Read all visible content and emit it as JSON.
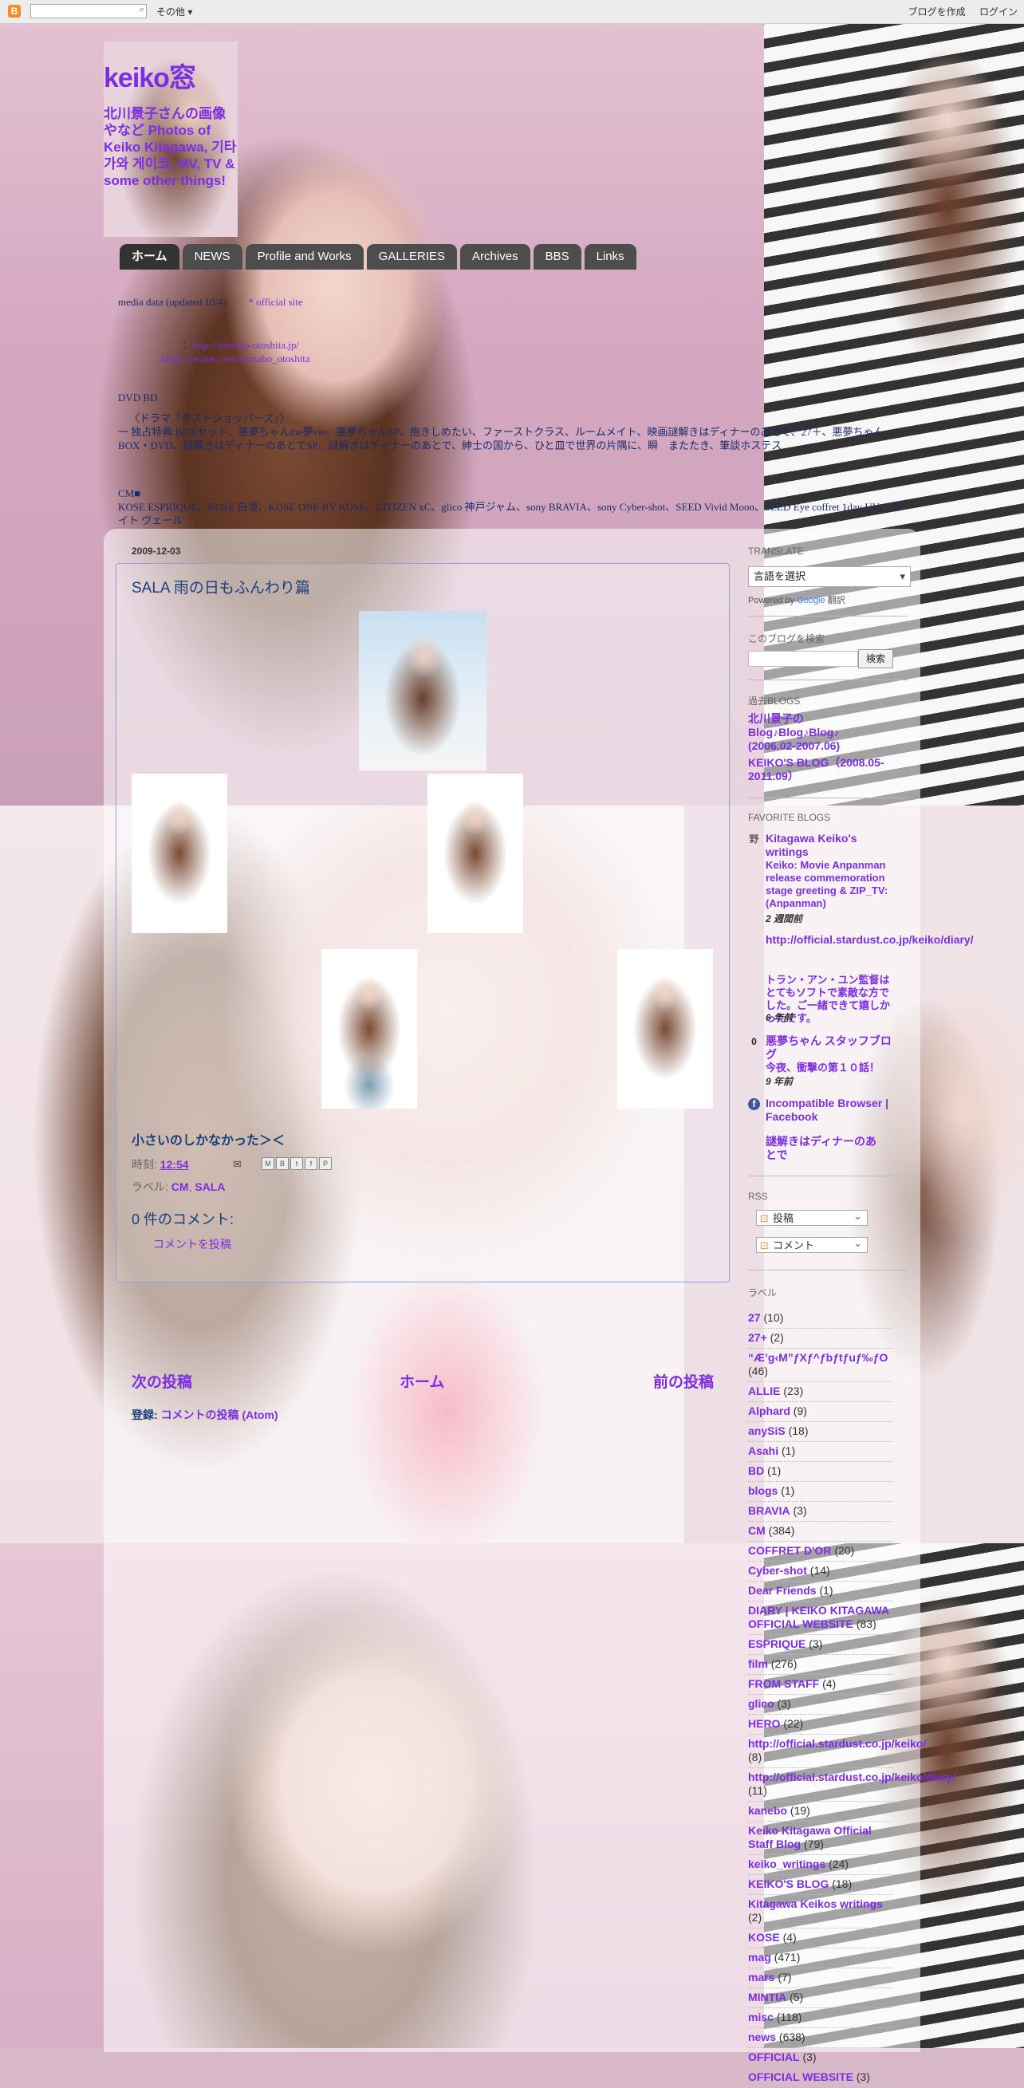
{
  "navbar": {
    "logo": "B",
    "search_icon": "search-icon",
    "more": "その他",
    "create_blog": "ブログを作成",
    "login": "ログイン"
  },
  "header": {
    "title": "keiko窓",
    "description": "北川景子さんの画像やなど Photos of Keiko Kitagawa, 기타가와 게이코, MV, TV & some other things!"
  },
  "tabs": [
    "ホーム",
    "NEWS",
    "Profile and Works",
    "GALLERIES",
    "Archives",
    "BBS",
    "Links"
  ],
  "topinfo": {
    "line1a": "media data (updated 10/4)",
    "line1b": "* official site",
    "line2_url": "http://sumaho-otoshita.jp/",
    "line3_url": "https://twitter.com/sumaho_otoshita",
    "line4": "DVD BD",
    "line5": "〈ドラマ「ダストショッパーズ」〉",
    "line6": "一 独占特典 BOXセット、悪夢ちゃんthe夢vie、悪夢ちゃんSP、抱きしめたい、ファーストクラス、ルームメイト、映画謎解きはディナーのあとで、27＋、悪夢ちゃん BOX・DVD、謎解きはディナーのあとでSP、謎解きはディナーのあとで、紳士の国から、ひと皿で世界の片隅に、瞬　またたき、筆談ホステス",
    "line7": "CM■",
    "line8": "KOSE ESPRIQUE、KOSE 白澄、KOSE ONE BY KOSE、CITIZEN xC、glico 神戸ジャム、sony BRAVIA、sony Cyber-shot、SEED Vivid Moon、SEED Eye coffret 1day UV、ライト ヴェール"
  },
  "post": {
    "date": "2009-12-03",
    "title": "SALA 雨の日もふんわり篇",
    "closing_line": "小さいのしかなかった＞＜",
    "posted_label": "時刻:",
    "time": "12:54",
    "labels_label": "ラベル:",
    "labels": [
      "CM",
      "SALA"
    ],
    "share_buttons": [
      "M",
      "B",
      "t",
      "f",
      "P"
    ],
    "comments_heading": "0 件のコメント:",
    "post_comment": "コメントを投稿"
  },
  "pager": {
    "newer": "次の投稿",
    "home": "ホーム",
    "older": "前の投稿"
  },
  "subscribe": {
    "label": "登録:",
    "link": "コメントの投稿 (Atom)"
  },
  "sidebar": {
    "translate_heading": "TRANSLATE",
    "translate_select": "言語を選択",
    "powered_by": "Powered by",
    "google": "Google",
    "translate_word": "翻訳",
    "search_heading": "このブログを検索",
    "search_button": "検索",
    "past_heading": "過去BLOGS",
    "past_links": [
      "北川景子の Blog♪Blog♪Blog♪ (2006.02-2007.06)",
      "KEIKO'S BLOG（2008.05-2011.09）"
    ],
    "fav_heading": "FAVORITE BLOGS",
    "favorites": [
      {
        "icon": "blog-icon",
        "title": "Kitagawa Keiko's writings",
        "snippet": "Keiko: Movie Anpanman release commemoration stage greeting & ZIP_TV: (Anpanman)",
        "ago": "2 週間前"
      },
      {
        "icon": "",
        "title": "http://official.stardust.co.jp/keiko/diary/",
        "snippet": "トラン・アン・ユン監督はとてもソフトで素敵な方でした。ご一緒できて嬉しかったです。",
        "ago": "6 年前"
      },
      {
        "icon": "ameba-icon",
        "title": "悪夢ちゃん スタッフブログ",
        "snippet": "今夜、衝撃の第１０話！",
        "ago": "9 年前"
      },
      {
        "icon": "facebook-icon",
        "title": "Incompatible Browser | Facebook",
        "snippet": "",
        "ago": ""
      },
      {
        "icon": "",
        "title": "謎解きはディナーのあとで",
        "snippet": "",
        "ago": ""
      }
    ],
    "rss_heading": "RSS",
    "rss_posts": "投稿",
    "rss_comments": "コメント",
    "labels_heading": "ラベル",
    "labels": [
      {
        "name": "27",
        "count": "(10)"
      },
      {
        "name": "27+",
        "count": "(2)"
      },
      {
        "name": "“Æ’g‹M”ƒXƒ^ƒbƒtƒuƒ‰ƒO",
        "count": "(46)"
      },
      {
        "name": "ALLIE",
        "count": "(23)"
      },
      {
        "name": "Alphard",
        "count": "(9)"
      },
      {
        "name": "anySiS",
        "count": "(18)"
      },
      {
        "name": "Asahi",
        "count": "(1)"
      },
      {
        "name": "BD",
        "count": "(1)"
      },
      {
        "name": "blogs",
        "count": "(1)"
      },
      {
        "name": "BRAVIA",
        "count": "(3)"
      },
      {
        "name": "CM",
        "count": "(384)"
      },
      {
        "name": "COFFRET D'OR",
        "count": "(20)"
      },
      {
        "name": "Cyber-shot",
        "count": "(14)"
      },
      {
        "name": "Dear Friends",
        "count": "(1)"
      },
      {
        "name": "DIARY | KEIKO KITAGAWA OFFICIAL WEBSITE",
        "count": "(83)"
      },
      {
        "name": "ESPRIQUE",
        "count": "(3)"
      },
      {
        "name": "film",
        "count": "(276)"
      },
      {
        "name": "FROM STAFF",
        "count": "(4)"
      },
      {
        "name": "glico",
        "count": "(3)"
      },
      {
        "name": "HERO",
        "count": "(22)"
      },
      {
        "name": "http://official.stardust.co.jp/keiko/",
        "count": "(8)"
      },
      {
        "name": "http://official.stardust.co.jp/keiko/diary/",
        "count": "(11)"
      },
      {
        "name": "kanebo",
        "count": "(19)"
      },
      {
        "name": "Keiko Kitagawa Official Staff Blog",
        "count": "(79)"
      },
      {
        "name": "keiko_writings",
        "count": "(24)"
      },
      {
        "name": "KEIKO'S BLOG",
        "count": "(18)"
      },
      {
        "name": "Kitagawa Keikos writings",
        "count": "(2)"
      },
      {
        "name": "KOSE",
        "count": "(4)"
      },
      {
        "name": "mag",
        "count": "(471)"
      },
      {
        "name": "mars",
        "count": "(7)"
      },
      {
        "name": "MINTIA",
        "count": "(5)"
      },
      {
        "name": "misc",
        "count": "(118)"
      },
      {
        "name": "news",
        "count": "(638)"
      },
      {
        "name": "OFFICIAL",
        "count": "(3)"
      },
      {
        "name": "OFFICIAL WEBSITE",
        "count": "(3)"
      }
    ]
  }
}
